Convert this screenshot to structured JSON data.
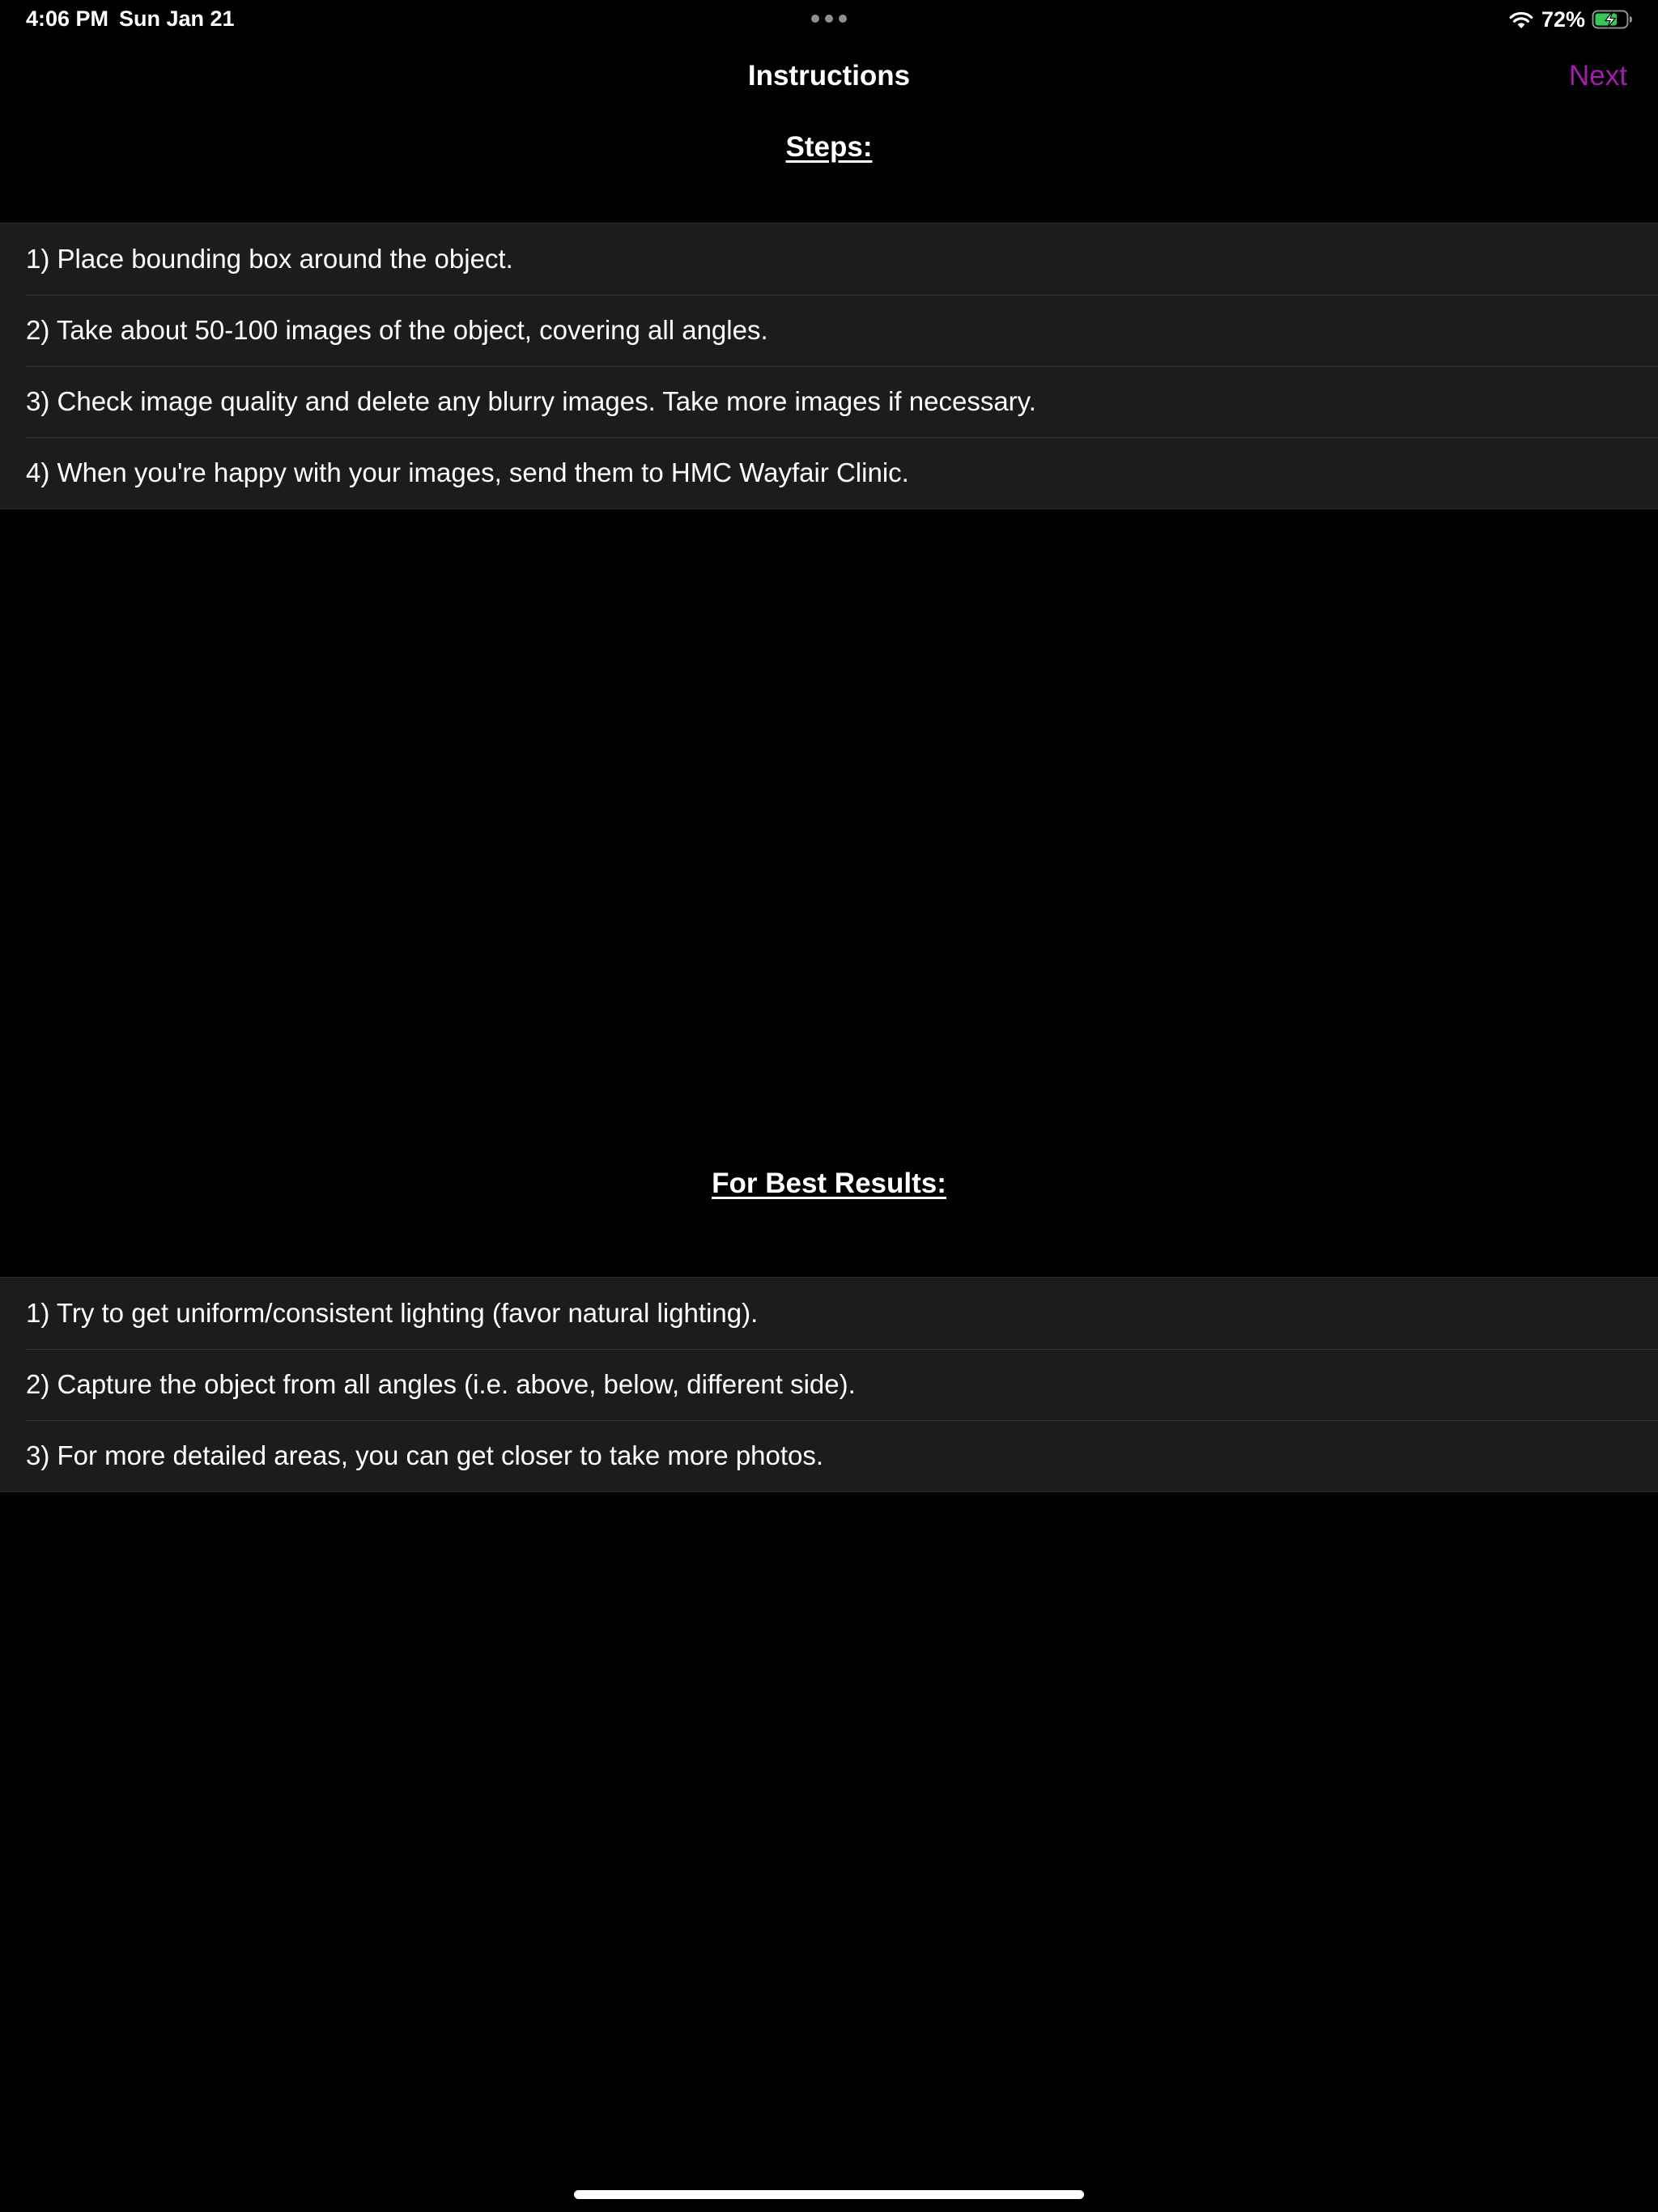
{
  "status_bar": {
    "time": "4:06 PM",
    "date": "Sun Jan 21",
    "battery_percent": "72%",
    "battery_level": 0.72,
    "icons": [
      "multitask-dots-icon",
      "wifi-icon",
      "battery-charging-icon"
    ]
  },
  "nav": {
    "title": "Instructions",
    "next_label": "Next",
    "accent_color": "#a21caf"
  },
  "steps": {
    "header": "Steps:",
    "items": [
      "1) Place bounding box around the object.",
      "2) Take about 50-100 images of the object, covering all angles.",
      "3) Check image quality and delete any blurry images. Take more images if necessary.",
      "4) When you're happy with your images, send them to HMC Wayfair Clinic."
    ]
  },
  "best_results": {
    "header": "For Best Results:",
    "items": [
      "1) Try to get uniform/consistent lighting (favor natural lighting).",
      "2) Capture the object from all angles (i.e. above, below, different side).",
      "3) For more detailed areas, you can get closer to take more photos."
    ]
  }
}
